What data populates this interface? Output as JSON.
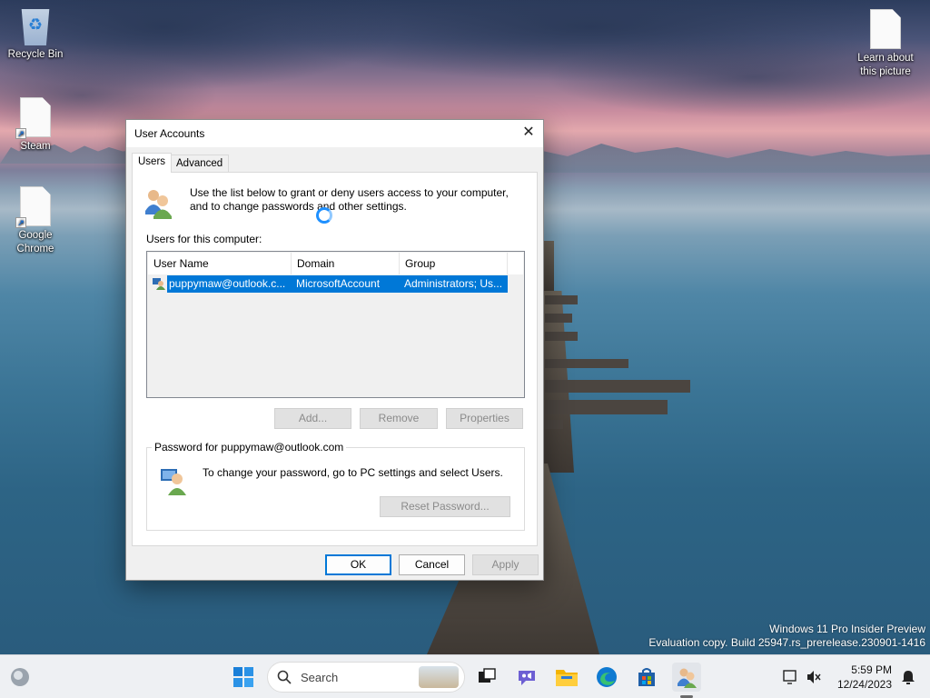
{
  "desktop": {
    "icons": [
      {
        "label": "Recycle Bin"
      },
      {
        "label": "Steam"
      },
      {
        "label": "Google Chrome"
      },
      {
        "label": "Learn about this picture"
      }
    ],
    "watermark_line1": "Windows 11 Pro Insider Preview",
    "watermark_line2": "Evaluation copy. Build 25947.rs_prerelease.230901-1416"
  },
  "dialog": {
    "title": "User Accounts",
    "close_glyph": "✕",
    "tabs": [
      {
        "label": "Users",
        "active": true
      },
      {
        "label": "Advanced",
        "active": false
      }
    ],
    "intro_text": "Use the list below to grant or deny users access to your computer, and to change passwords and other settings.",
    "users_label": "Users for this computer:",
    "list": {
      "columns": [
        "User Name",
        "Domain",
        "Group"
      ],
      "rows": [
        {
          "user": "puppymaw@outlook.c...",
          "domain": "MicrosoftAccount",
          "group": "Administrators; Us...",
          "selected": true
        }
      ]
    },
    "buttons": {
      "add": "Add...",
      "remove": "Remove",
      "properties": "Properties",
      "reset_password": "Reset Password...",
      "ok": "OK",
      "cancel": "Cancel",
      "apply": "Apply"
    },
    "password_group_label": "Password for puppymaw@outlook.com",
    "password_text": "To change your password, go to PC settings and select Users."
  },
  "taskbar": {
    "search_placeholder": "Search",
    "time": "5:59 PM",
    "date": "12/24/2023",
    "icons": [
      "widgets-icon",
      "start-icon",
      "task-view-icon",
      "teams-chat-icon",
      "file-explorer-icon",
      "edge-icon",
      "store-icon",
      "user-accounts-icon"
    ]
  },
  "colors": {
    "selection": "#0078d7",
    "dialog_bg": "#f0f0f0",
    "taskbar_bg": "#eef0f3"
  }
}
